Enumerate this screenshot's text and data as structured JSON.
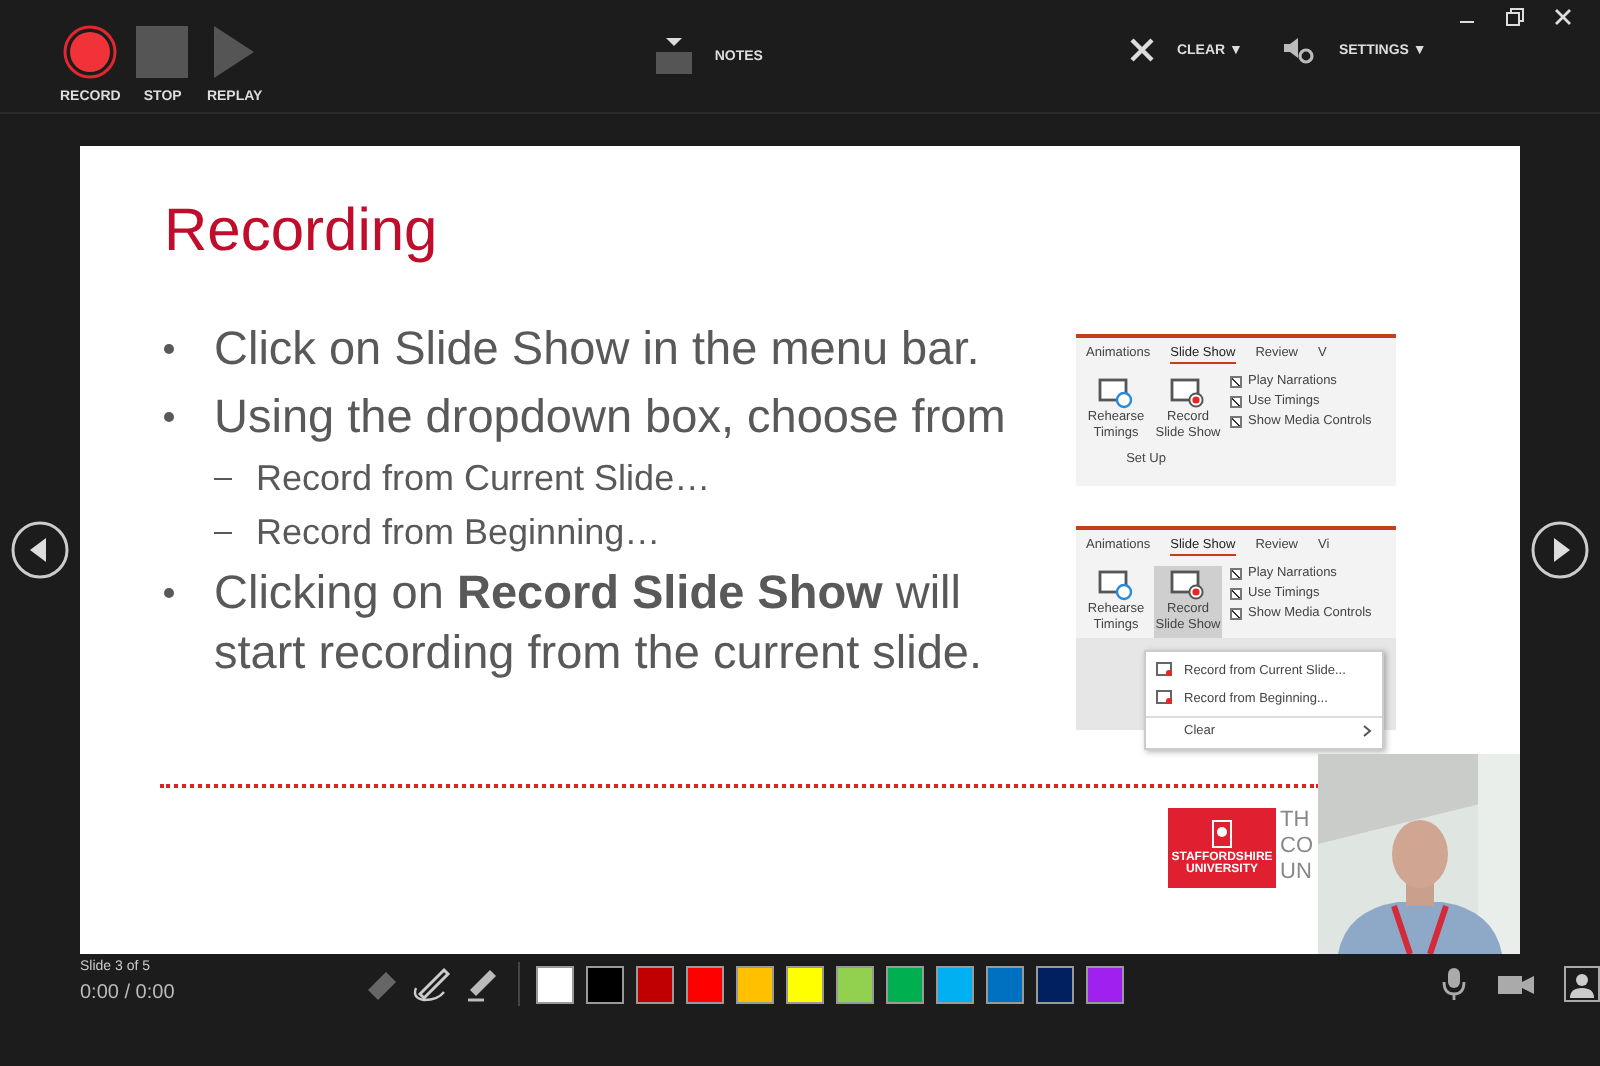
{
  "toolbar": {
    "buttons": [
      {
        "kind": "record",
        "label": "RECORD"
      },
      {
        "kind": "stop",
        "label": "STOP"
      },
      {
        "kind": "replay",
        "label": "REPLAY"
      }
    ],
    "notes": {
      "label": "NOTES"
    },
    "clear": {
      "label": "CLEAR ▼"
    },
    "settings": {
      "label": "SETTINGS ▼"
    }
  },
  "slide": {
    "title": "Recording",
    "bullets": [
      {
        "text": "Click on Slide Show in the menu bar."
      },
      {
        "text": "Using the dropdown box, choose from",
        "children": [
          "Record from Current Slide…",
          "Record from Beginning…"
        ]
      },
      {
        "text": "Clicking on **Record Slide Show** will start recording from the current slide."
      }
    ],
    "insets": [
      {
        "tabs": [
          {
            "label": "Animations",
            "selected": false
          },
          {
            "label": "Slide Show",
            "selected": true
          },
          {
            "label": "Review",
            "selected": false
          },
          {
            "label": "V",
            "selected": false
          }
        ],
        "buttons": [
          {
            "kind": "rehearse",
            "label": "Rehearse Timings",
            "selected": false
          },
          {
            "kind": "record",
            "label": "Record Slide Show",
            "selected": false
          }
        ],
        "options": [
          {
            "label": "Play Narrations",
            "checked": true
          },
          {
            "label": "Use Timings",
            "checked": true
          },
          {
            "label": "Show Media Controls",
            "checked": true
          }
        ],
        "group_label": "Set Up"
      },
      {
        "tabs": [
          {
            "label": "Animations",
            "selected": false
          },
          {
            "label": "Slide Show",
            "selected": true
          },
          {
            "label": "Review",
            "selected": false
          },
          {
            "label": "Vi",
            "selected": false
          }
        ],
        "buttons": [
          {
            "kind": "rehearse",
            "label": "Rehearse Timings",
            "selected": false
          },
          {
            "kind": "record",
            "label": "Record Slide Show",
            "selected": true
          }
        ],
        "options": [
          {
            "label": "Play Narrations",
            "checked": true
          },
          {
            "label": "Use Timings",
            "checked": true
          },
          {
            "label": "Show Media Controls",
            "checked": true
          }
        ],
        "menu": [
          {
            "kind": "item",
            "label": "Record from Current Slide..."
          },
          {
            "kind": "item",
            "label": "Record from Beginning..."
          },
          {
            "kind": "submenu",
            "label": "Clear"
          }
        ]
      }
    ],
    "logo": {
      "text": "STAFFORDSHIRE UNIVERSITY",
      "tagline": [
        "TH",
        "CO",
        "UN"
      ]
    }
  },
  "bottom": {
    "slide_counter": "Slide 3 of 5",
    "time": "0:00 / 0:00",
    "pen_tools": [
      {
        "kind": "eraser"
      },
      {
        "kind": "pen"
      },
      {
        "kind": "highlighter"
      }
    ],
    "colors": [
      {
        "color": "#ffffff"
      },
      {
        "color": "#000000"
      },
      {
        "color": "#c00000"
      },
      {
        "color": "#ff0000"
      },
      {
        "color": "#ffc000"
      },
      {
        "color": "#ffff00"
      },
      {
        "color": "#92d050"
      },
      {
        "color": "#00b050"
      },
      {
        "color": "#00b0f0"
      },
      {
        "color": "#0070c0"
      },
      {
        "color": "#002060"
      },
      {
        "color": "#a020f0"
      }
    ]
  }
}
